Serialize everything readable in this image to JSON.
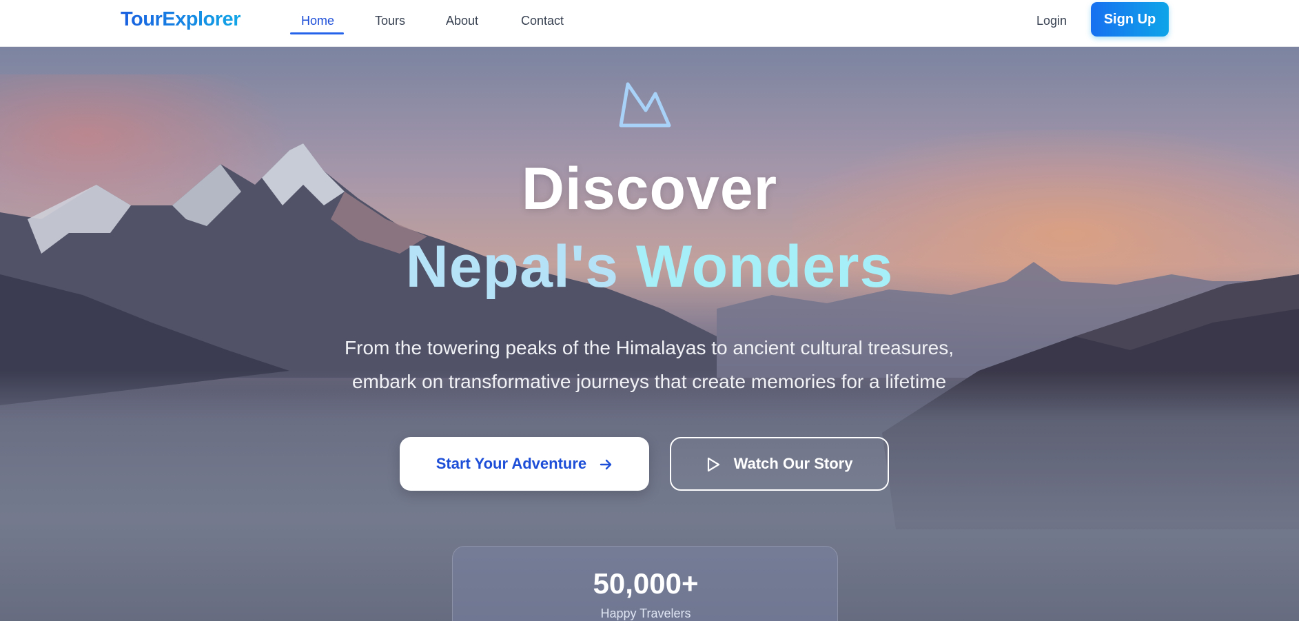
{
  "brand": {
    "name": "TourExplorer"
  },
  "nav": {
    "links": [
      {
        "label": "Home",
        "active": true
      },
      {
        "label": "Tours",
        "active": false
      },
      {
        "label": "About",
        "active": false
      },
      {
        "label": "Contact",
        "active": false
      }
    ],
    "login_label": "Login",
    "signup_label": "Sign Up"
  },
  "hero": {
    "icon": "mountain-icon",
    "headline_line1": "Discover",
    "headline_line2_part1": "Nepal's",
    "headline_line2_part2": "Wonders",
    "subtext_line1": "From the towering peaks of the Himalayas to ancient cultural treasures,",
    "subtext_line2": "embark on transformative journeys that create memories for a lifetime",
    "primary_cta": "Start Your Adventure",
    "secondary_cta": "Watch Our Story"
  },
  "stats": {
    "value": "50,000+",
    "label": "Happy Travelers"
  },
  "colors": {
    "brand_blue": "#1d6fe6",
    "accent_cyan": "#0ea5e9",
    "headline_blue": "#b6e2f7",
    "headline_cyan": "#a6eef8"
  }
}
